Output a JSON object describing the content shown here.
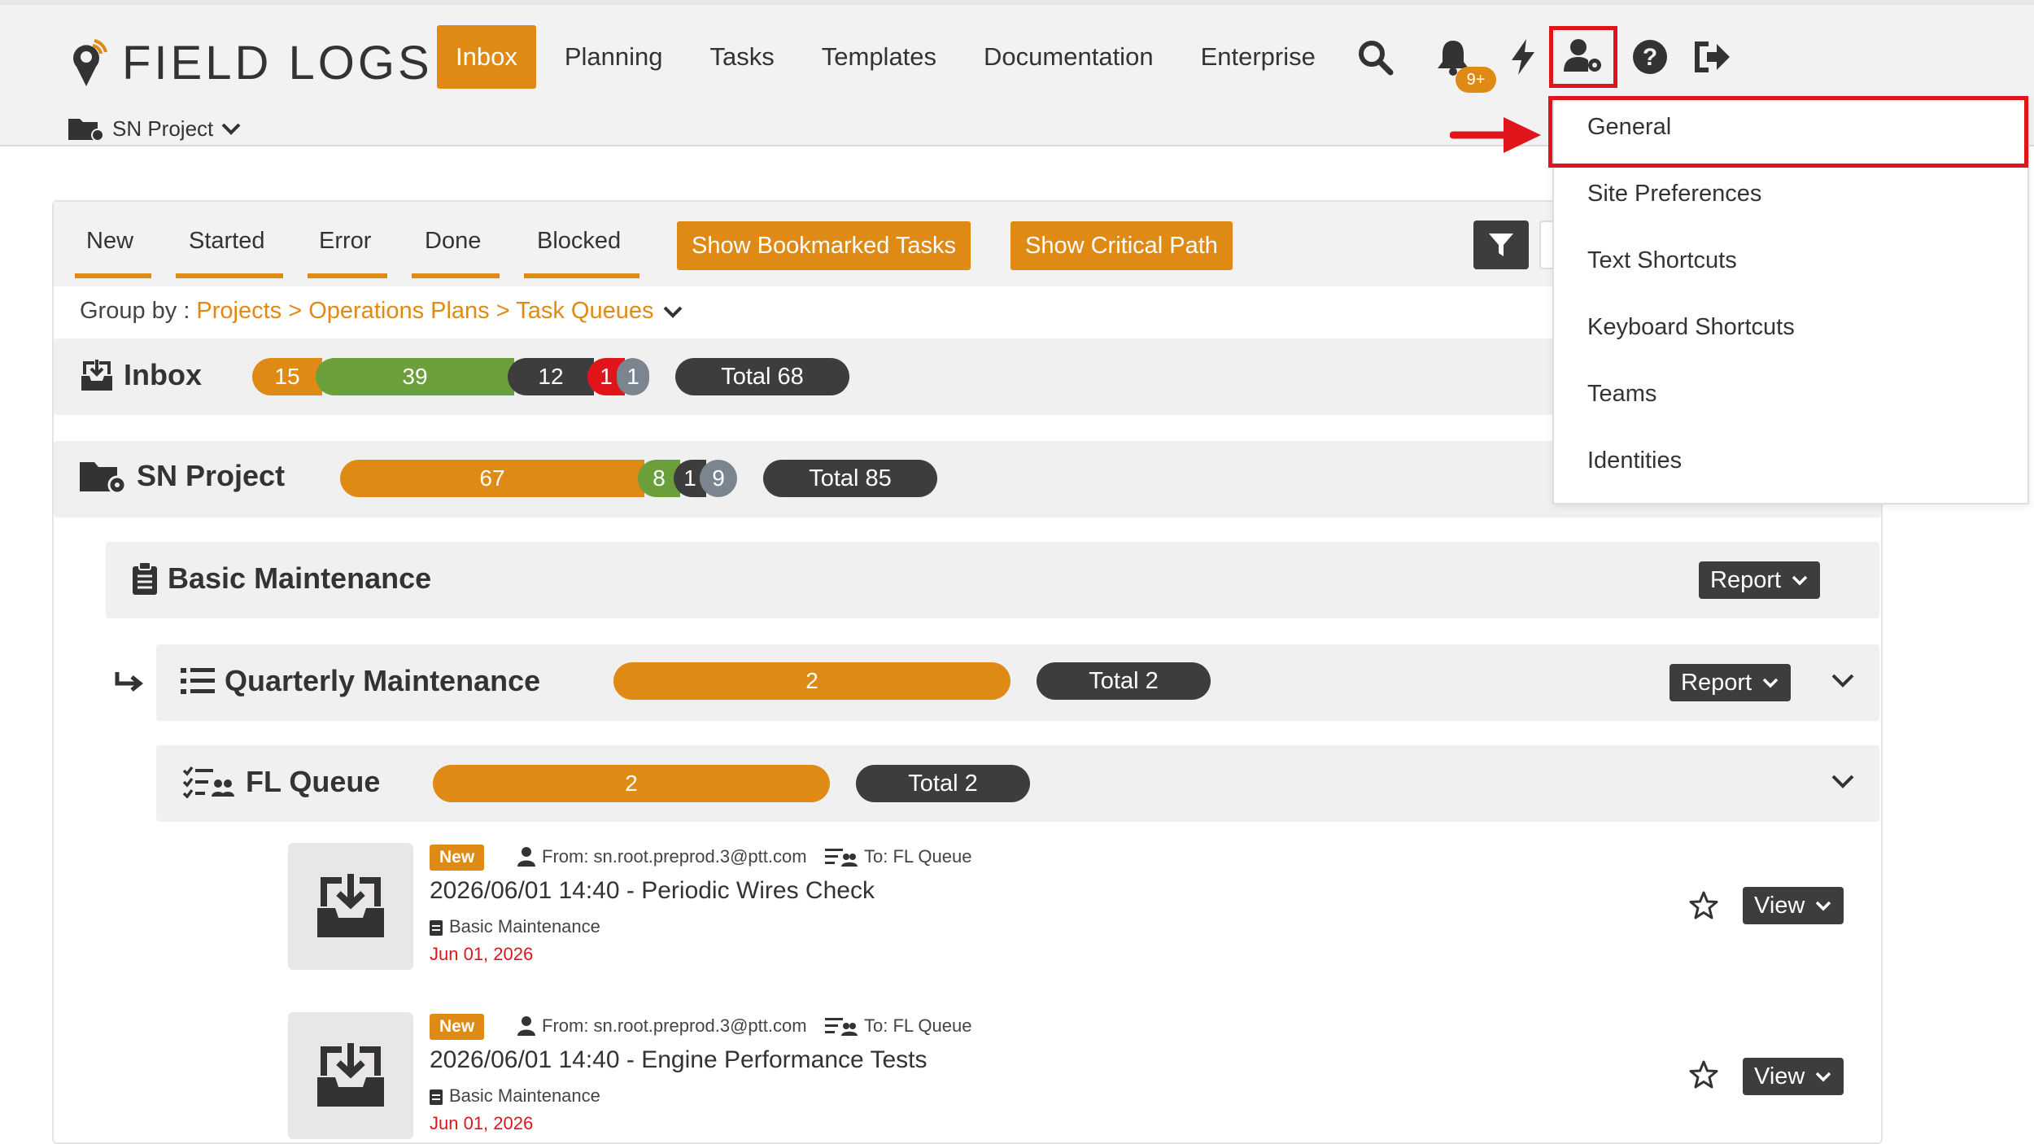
{
  "header": {
    "logo_text": "FIELD LOGS",
    "nav": [
      "Inbox",
      "Planning",
      "Tasks",
      "Templates",
      "Documentation",
      "Enterprise"
    ],
    "active_nav": "Inbox",
    "notification_badge": "9+",
    "project_selector": "SN Project"
  },
  "user_menu": {
    "items": [
      "General",
      "Site Preferences",
      "Text Shortcuts",
      "Keyboard Shortcuts",
      "Teams",
      "Identities"
    ],
    "highlighted_item": "General"
  },
  "tabs": [
    "New",
    "Started",
    "Error",
    "Done",
    "Blocked"
  ],
  "buttons": {
    "bookmarked": "Show Bookmarked Tasks",
    "critical_path": "Show Critical Path"
  },
  "groupby": {
    "label": "Group by :",
    "path": "Projects > Operations Plans > Task Queues"
  },
  "groups": {
    "inbox": {
      "title": "Inbox",
      "counts": {
        "new": "15",
        "started": "39",
        "done": "12",
        "error": "1",
        "blocked": "1"
      },
      "total": "Total 68"
    },
    "project": {
      "title": "SN Project",
      "counts": {
        "new": "67",
        "started": "8",
        "done": "1",
        "blocked": "9"
      },
      "total": "Total 85"
    },
    "plan": {
      "title": "Basic Maintenance",
      "report_label": "Report"
    },
    "sub_plan": {
      "title": "Quarterly Maintenance",
      "count": "2",
      "total": "Total 2",
      "report_label": "Report"
    },
    "queue": {
      "title": "FL Queue",
      "count": "2",
      "total": "Total 2"
    }
  },
  "tasks": [
    {
      "status": "New",
      "from": "From: sn.root.preprod.3@ptt.com",
      "to": "To: FL Queue",
      "title": "2026/06/01 14:40 - Periodic Wires Check",
      "plan": "Basic Maintenance",
      "date": "Jun 01, 2026",
      "view_label": "View"
    },
    {
      "status": "New",
      "from": "From: sn.root.preprod.3@ptt.com",
      "to": "To: FL Queue",
      "title": "2026/06/01 14:40 - Engine Performance Tests",
      "plan": "Basic Maintenance",
      "date": "Jun 01, 2026",
      "view_label": "View"
    }
  ],
  "colors": {
    "accent": "#e08a16",
    "green": "#6b9f3a",
    "dark": "#3d3d3d",
    "error": "#e0151c",
    "grey": "#7b8590",
    "highlight": "#e0151c"
  }
}
